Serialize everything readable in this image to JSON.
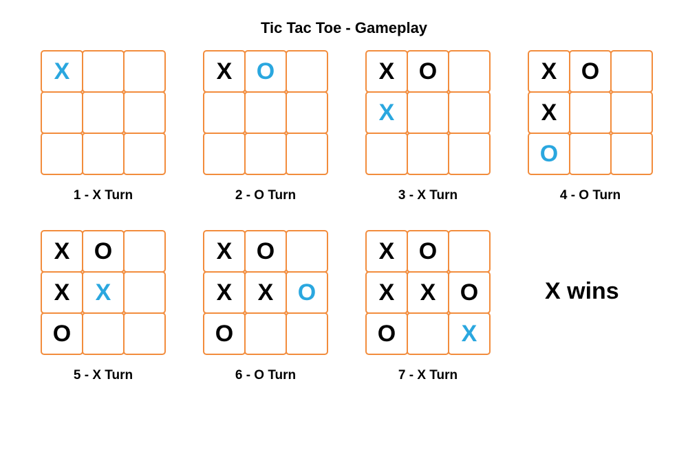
{
  "title": "Tic Tac Toe - Gameplay",
  "result": "X wins",
  "boards": [
    {
      "caption": "1 - X Turn",
      "cells": [
        {
          "v": "X",
          "c": "blue"
        },
        {
          "v": "",
          "c": ""
        },
        {
          "v": "",
          "c": ""
        },
        {
          "v": "",
          "c": ""
        },
        {
          "v": "",
          "c": ""
        },
        {
          "v": "",
          "c": ""
        },
        {
          "v": "",
          "c": ""
        },
        {
          "v": "",
          "c": ""
        },
        {
          "v": "",
          "c": ""
        }
      ]
    },
    {
      "caption": "2 - O Turn",
      "cells": [
        {
          "v": "X",
          "c": "black"
        },
        {
          "v": "O",
          "c": "blue"
        },
        {
          "v": "",
          "c": ""
        },
        {
          "v": "",
          "c": ""
        },
        {
          "v": "",
          "c": ""
        },
        {
          "v": "",
          "c": ""
        },
        {
          "v": "",
          "c": ""
        },
        {
          "v": "",
          "c": ""
        },
        {
          "v": "",
          "c": ""
        }
      ]
    },
    {
      "caption": "3 - X Turn",
      "cells": [
        {
          "v": "X",
          "c": "black"
        },
        {
          "v": "O",
          "c": "black"
        },
        {
          "v": "",
          "c": ""
        },
        {
          "v": "X",
          "c": "blue"
        },
        {
          "v": "",
          "c": ""
        },
        {
          "v": "",
          "c": ""
        },
        {
          "v": "",
          "c": ""
        },
        {
          "v": "",
          "c": ""
        },
        {
          "v": "",
          "c": ""
        }
      ]
    },
    {
      "caption": "4 - O Turn",
      "cells": [
        {
          "v": "X",
          "c": "black"
        },
        {
          "v": "O",
          "c": "black"
        },
        {
          "v": "",
          "c": ""
        },
        {
          "v": "X",
          "c": "black"
        },
        {
          "v": "",
          "c": ""
        },
        {
          "v": "",
          "c": ""
        },
        {
          "v": "O",
          "c": "blue"
        },
        {
          "v": "",
          "c": ""
        },
        {
          "v": "",
          "c": ""
        }
      ]
    },
    {
      "caption": "5 - X Turn",
      "cells": [
        {
          "v": "X",
          "c": "black"
        },
        {
          "v": "O",
          "c": "black"
        },
        {
          "v": "",
          "c": ""
        },
        {
          "v": "X",
          "c": "black"
        },
        {
          "v": "X",
          "c": "blue"
        },
        {
          "v": "",
          "c": ""
        },
        {
          "v": "O",
          "c": "black"
        },
        {
          "v": "",
          "c": ""
        },
        {
          "v": "",
          "c": ""
        }
      ]
    },
    {
      "caption": "6 - O Turn",
      "cells": [
        {
          "v": "X",
          "c": "black"
        },
        {
          "v": "O",
          "c": "black"
        },
        {
          "v": "",
          "c": ""
        },
        {
          "v": "X",
          "c": "black"
        },
        {
          "v": "X",
          "c": "black"
        },
        {
          "v": "O",
          "c": "blue"
        },
        {
          "v": "O",
          "c": "black"
        },
        {
          "v": "",
          "c": ""
        },
        {
          "v": "",
          "c": ""
        }
      ]
    },
    {
      "caption": "7 - X Turn",
      "cells": [
        {
          "v": "X",
          "c": "black"
        },
        {
          "v": "O",
          "c": "black"
        },
        {
          "v": "",
          "c": ""
        },
        {
          "v": "X",
          "c": "black"
        },
        {
          "v": "X",
          "c": "black"
        },
        {
          "v": "O",
          "c": "black"
        },
        {
          "v": "O",
          "c": "black"
        },
        {
          "v": "",
          "c": ""
        },
        {
          "v": "X",
          "c": "blue"
        }
      ]
    }
  ]
}
